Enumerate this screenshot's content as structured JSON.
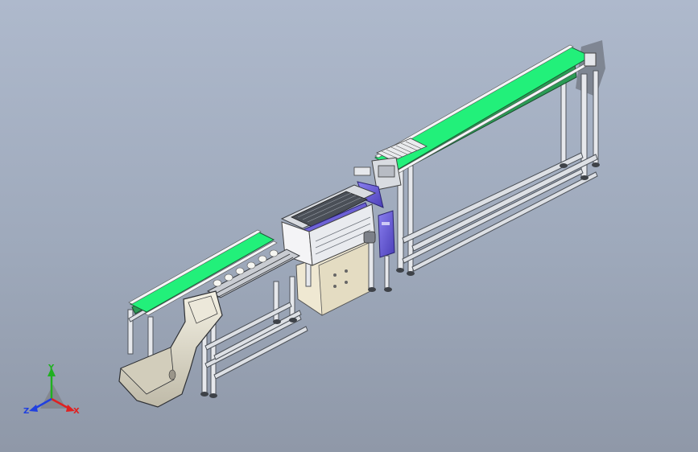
{
  "colors": {
    "background_top": "#aeb9cc",
    "background_bottom": "#8f98a8",
    "belt": "#22f07a",
    "frame": "#e3e6ea",
    "frame_shade": "#8c919a",
    "machine_purple": "#6e5fd8",
    "housing": "#f0ead8",
    "axis_x": "#e02020",
    "axis_y": "#20b020",
    "axis_z": "#2040e0"
  },
  "icons": {
    "triad": "coordinate-axes-icon"
  },
  "axes": {
    "x_label": "X",
    "y_label": "Y",
    "z_label": "Z"
  }
}
